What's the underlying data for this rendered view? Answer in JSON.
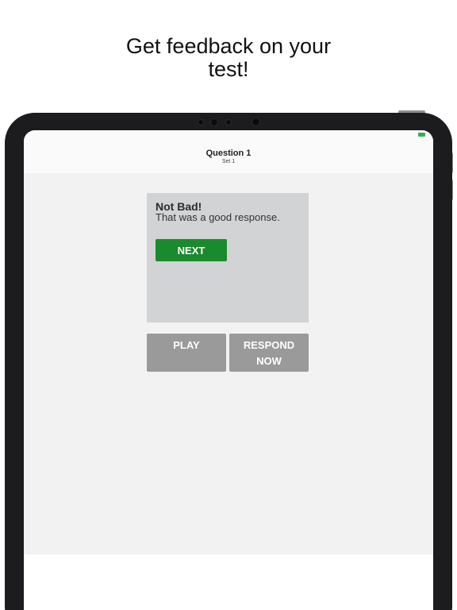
{
  "headline": {
    "line1": "Get feedback on your",
    "line2": "test!"
  },
  "nav": {
    "title": "Question 1",
    "subtitle": "Set 1"
  },
  "feedback": {
    "title": "Not Bad!",
    "message": "That was a good response.",
    "next_label": "NEXT"
  },
  "actions": {
    "play_label": "PLAY",
    "respond_line1": "RESPOND",
    "respond_line2": "NOW"
  },
  "colors": {
    "next_button": "#1a8a2e",
    "action_button": "#9a9a9a",
    "card_background": "#d1d3d4",
    "battery": "#2db34a"
  }
}
